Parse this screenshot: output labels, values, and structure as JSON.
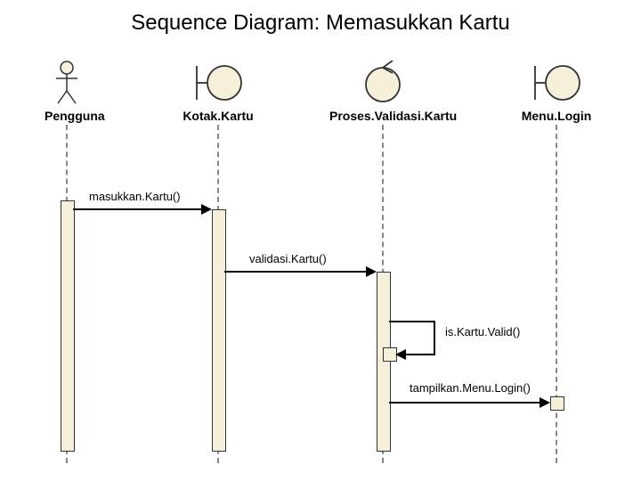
{
  "title": "Sequence Diagram: Memasukkan Kartu",
  "participants": {
    "pengguna": {
      "label": "Pengguna",
      "kind": "actor"
    },
    "kotakKartu": {
      "label": "Kotak.Kartu",
      "kind": "boundary"
    },
    "prosesValidasi": {
      "label": "Proses.Validasi.Kartu",
      "kind": "control"
    },
    "menuLogin": {
      "label": "Menu.Login",
      "kind": "boundary"
    }
  },
  "messages": {
    "m1": {
      "text": "masukkan.Kartu()",
      "from": "Pengguna",
      "to": "Kotak.Kartu"
    },
    "m2": {
      "text": "validasi.Kartu()",
      "from": "Kotak.Kartu",
      "to": "Proses.Validasi.Kartu"
    },
    "m3": {
      "text": "is.Kartu.Valid()",
      "from": "Proses.Validasi.Kartu",
      "to": "Proses.Validasi.Kartu"
    },
    "m4": {
      "text": "tampilkan.Menu.Login()",
      "from": "Proses.Validasi.Kartu",
      "to": "Menu.Login"
    }
  }
}
